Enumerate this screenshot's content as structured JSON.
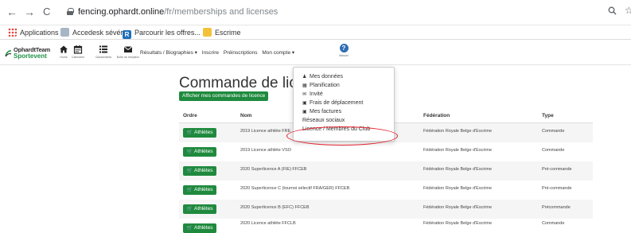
{
  "browser": {
    "back": "←",
    "forward": "→",
    "reload": "C",
    "url_host": "fencing.ophardt.online",
    "url_path": "/fr/memberships and licenses",
    "right_icons": [
      "search-icon",
      "star-icon"
    ]
  },
  "bookmarks": [
    {
      "label": "Applications",
      "icon": "apps-grid-icon"
    },
    {
      "label": "Accedesk sévérer",
      "icon": "page-icon"
    },
    {
      "label": "Parcourir les offres...",
      "icon": "r-icon"
    },
    {
      "label": "Escrime",
      "icon": "folder-icon"
    }
  ],
  "site": {
    "logo_line1": "OphardtTeam",
    "logo_line2": "Sportevent",
    "nav_icons": [
      {
        "icon": "home-icon",
        "caption": "Home"
      },
      {
        "icon": "calendar-icon",
        "caption": "Calendrier"
      },
      {
        "icon": "list-icon",
        "caption": "Classements"
      },
      {
        "icon": "mail-icon",
        "caption": "Boîte de réception"
      }
    ],
    "menu": [
      "Résultats / Biographies ▾",
      "Inscrire",
      "Préinscriptions",
      "Mon compte ▾"
    ],
    "help_caption": "Manuel"
  },
  "page": {
    "title": "Commande de licen",
    "my_orders_button": "Afficher mes commandes de licence"
  },
  "table": {
    "headers": [
      "Ordre",
      "Nom",
      "Fédération",
      "Type"
    ],
    "button_label": "Athlètes",
    "rows": [
      {
        "nom": "2019 Licence athlète FRE",
        "federation": "Fédération Royale Belge d'Escrime",
        "type": "Commande"
      },
      {
        "nom": "2019 Licence athlète VSO",
        "federation": "Fédération Royale Belge d'Escrime",
        "type": "Commande"
      },
      {
        "nom": "2020 Superlicence A (FIE) FFCEB",
        "federation": "Fédération Royale Belge d'Escrime",
        "type": "Pré-commande"
      },
      {
        "nom": "2020 Superlicence C (tournoi sélectif FRA/GER) FFCEB",
        "federation": "Fédération Royale Belge d'Escrime",
        "type": "Pré-commande"
      },
      {
        "nom": "2020 Superlicence B (EFC) FFCEB",
        "federation": "Fédération Royale Belge d'Escrime",
        "type": "Précommande"
      },
      {
        "nom": "2020 Licence athlète FFCLB",
        "federation": "Fédération Royale Belge d'Escrime",
        "type": "Commande"
      }
    ]
  },
  "dropdown": {
    "items": [
      {
        "icon": "user-icon",
        "glyph": "♟",
        "label": "Mes données"
      },
      {
        "icon": "calendar-icon",
        "glyph": "▦",
        "label": "Planification"
      },
      {
        "icon": "envelope-icon",
        "glyph": "✉",
        "label": "Invité"
      },
      {
        "icon": "money-icon",
        "glyph": "▣",
        "label": "Frais de déplacement"
      },
      {
        "icon": "money-icon",
        "glyph": "▣",
        "label": "Mes factures"
      },
      {
        "icon": "",
        "glyph": "",
        "label": "Réseaux sociaux"
      },
      {
        "icon": "",
        "glyph": "",
        "label": "Licence / Membres du Club"
      }
    ],
    "highlight_color": "#e0202a"
  },
  "colors": {
    "brand_green": "#1f8a3e",
    "help_blue": "#2f6db3"
  }
}
